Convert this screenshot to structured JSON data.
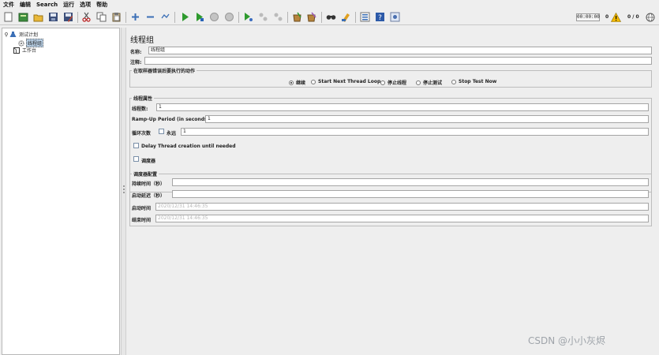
{
  "menu": [
    "文件",
    "编辑",
    "Search",
    "运行",
    "选项",
    "帮助"
  ],
  "toolbar": {
    "icons": [
      "new-icon",
      "templates-icon",
      "open-icon",
      "save-icon",
      "save-as-icon",
      "cut-icon",
      "copy-icon",
      "paste-icon",
      "expand-icon",
      "collapse-icon",
      "toggle-icon",
      "start-icon",
      "start-no-pause-icon",
      "stop-icon",
      "shutdown-icon",
      "remote-start-icon",
      "remote-stop-icon",
      "remote-shutdown-icon",
      "clear-icon",
      "clear-all-icon",
      "search-icon",
      "reset-search-icon",
      "function-helper-icon",
      "help-icon",
      "options-icon"
    ],
    "timer": "00:00:00",
    "warning_count": "0",
    "thread_count": "0 / 0"
  },
  "tree": {
    "test_plan": "测试计划",
    "thread_group": "线程组",
    "workbench": "工作台"
  },
  "panel": {
    "title": "线程组",
    "name_label": "名称:",
    "name_value": "线程组",
    "comment_label": "注释:",
    "comment_value": "",
    "error_action": {
      "title": "在取样器错误后要执行的动作",
      "options": [
        "继续",
        "Start Next Thread Loop",
        "停止线程",
        "停止测试",
        "Stop Test Now"
      ],
      "selected": "继续"
    },
    "thread_props": {
      "title": "线程属性",
      "threads_label": "线程数:",
      "threads_value": "1",
      "rampup_label": "Ramp-Up Period (in seconds):",
      "rampup_value": "1",
      "loop_label": "循环次数",
      "forever_label": "永远",
      "loop_value": "1",
      "delay_label": "Delay Thread creation until needed",
      "scheduler_label": "调度器"
    },
    "scheduler": {
      "title": "调度器配置",
      "duration_label": "持续时间（秒）",
      "duration_value": "",
      "delay_label": "启动延迟（秒）",
      "delay_value": "",
      "start_label": "启动时间",
      "start_value": "2020/12/31 14:46:35",
      "end_label": "结束时间",
      "end_value": "2020/12/31 14:46:35"
    }
  },
  "watermark": "CSDN @小小灰烬",
  "colors": {
    "accent_green": "#2e9a2e",
    "selection": "#b8cfe5",
    "warning": "#f2b900"
  }
}
